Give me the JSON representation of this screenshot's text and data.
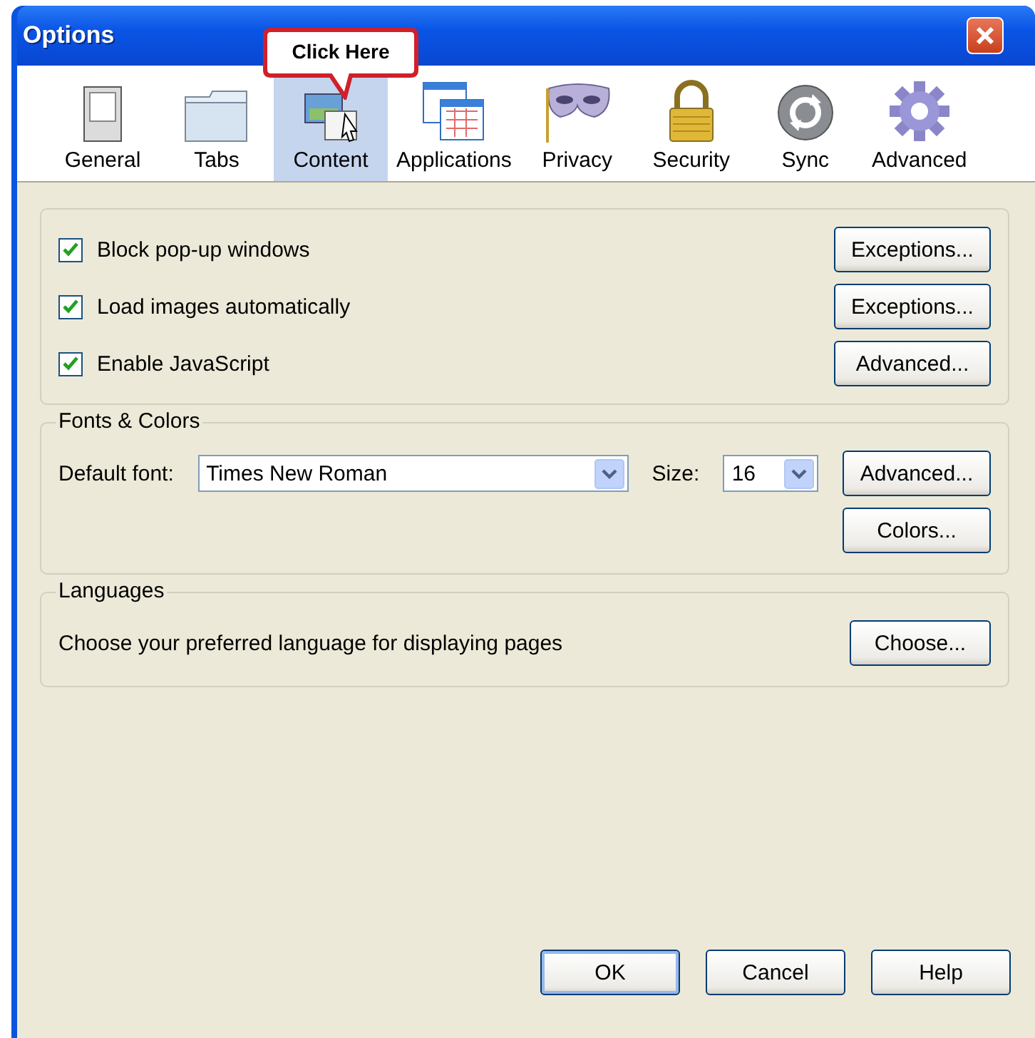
{
  "window": {
    "title": "Options"
  },
  "callout": {
    "text": "Click Here"
  },
  "tabs": [
    {
      "label": "General",
      "selected": false
    },
    {
      "label": "Tabs",
      "selected": false
    },
    {
      "label": "Content",
      "selected": true
    },
    {
      "label": "Applications",
      "selected": false
    },
    {
      "label": "Privacy",
      "selected": false
    },
    {
      "label": "Security",
      "selected": false
    },
    {
      "label": "Sync",
      "selected": false
    },
    {
      "label": "Advanced",
      "selected": false
    }
  ],
  "content_group": {
    "rows": [
      {
        "label": "Block pop-up windows",
        "checked": true,
        "button": "Exceptions..."
      },
      {
        "label": "Load images automatically",
        "checked": true,
        "button": "Exceptions..."
      },
      {
        "label": "Enable JavaScript",
        "checked": true,
        "button": "Advanced..."
      }
    ]
  },
  "fonts_group": {
    "title": "Fonts & Colors",
    "font_label": "Default font:",
    "font_value": "Times New Roman",
    "size_label": "Size:",
    "size_value": "16",
    "buttons": [
      "Advanced...",
      "Colors..."
    ]
  },
  "languages_group": {
    "title": "Languages",
    "text": "Choose your preferred language for displaying pages",
    "button": "Choose..."
  },
  "footer_buttons": [
    "OK",
    "Cancel",
    "Help"
  ]
}
